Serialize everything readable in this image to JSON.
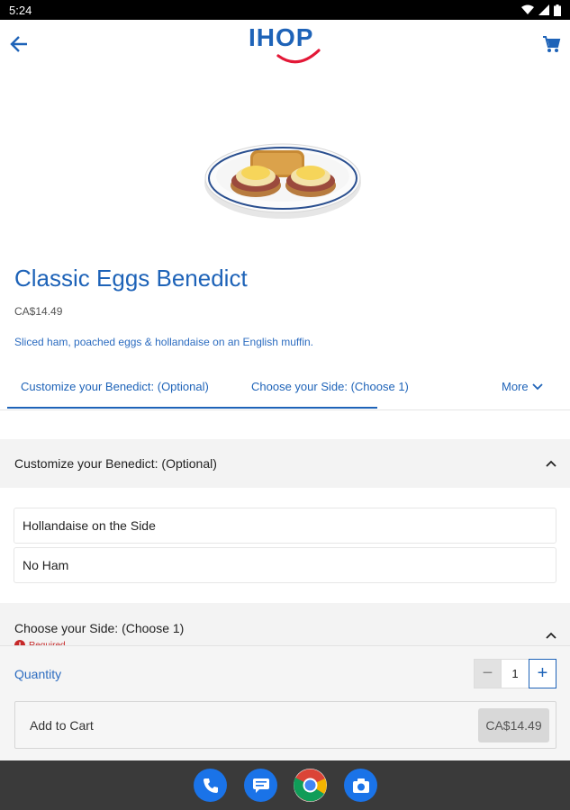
{
  "status_bar": {
    "time": "5:24"
  },
  "app_bar": {
    "logo_text": "IHOP"
  },
  "product": {
    "title": "Classic Eggs Benedict",
    "price": "CA$14.49",
    "description": "Sliced ham, poached eggs & hollandaise on an English muffin."
  },
  "tabs": {
    "items": [
      {
        "label": "Customize your Benedict: (Optional)"
      },
      {
        "label": "Choose your Side: (Choose 1)"
      }
    ],
    "more_label": "More"
  },
  "sections": {
    "customize": {
      "title": "Customize your Benedict: (Optional)",
      "options": [
        "Hollandaise on the Side",
        "No Ham"
      ]
    },
    "side": {
      "title": "Choose your Side: (Choose 1)",
      "required_label": "Required"
    }
  },
  "cart": {
    "quantity_label": "Quantity",
    "quantity_value": "1",
    "add_label": "Add to Cart",
    "amount": "CA$14.49"
  },
  "colors": {
    "brand_blue": "#1e63b8",
    "required_red": "#c62828"
  }
}
